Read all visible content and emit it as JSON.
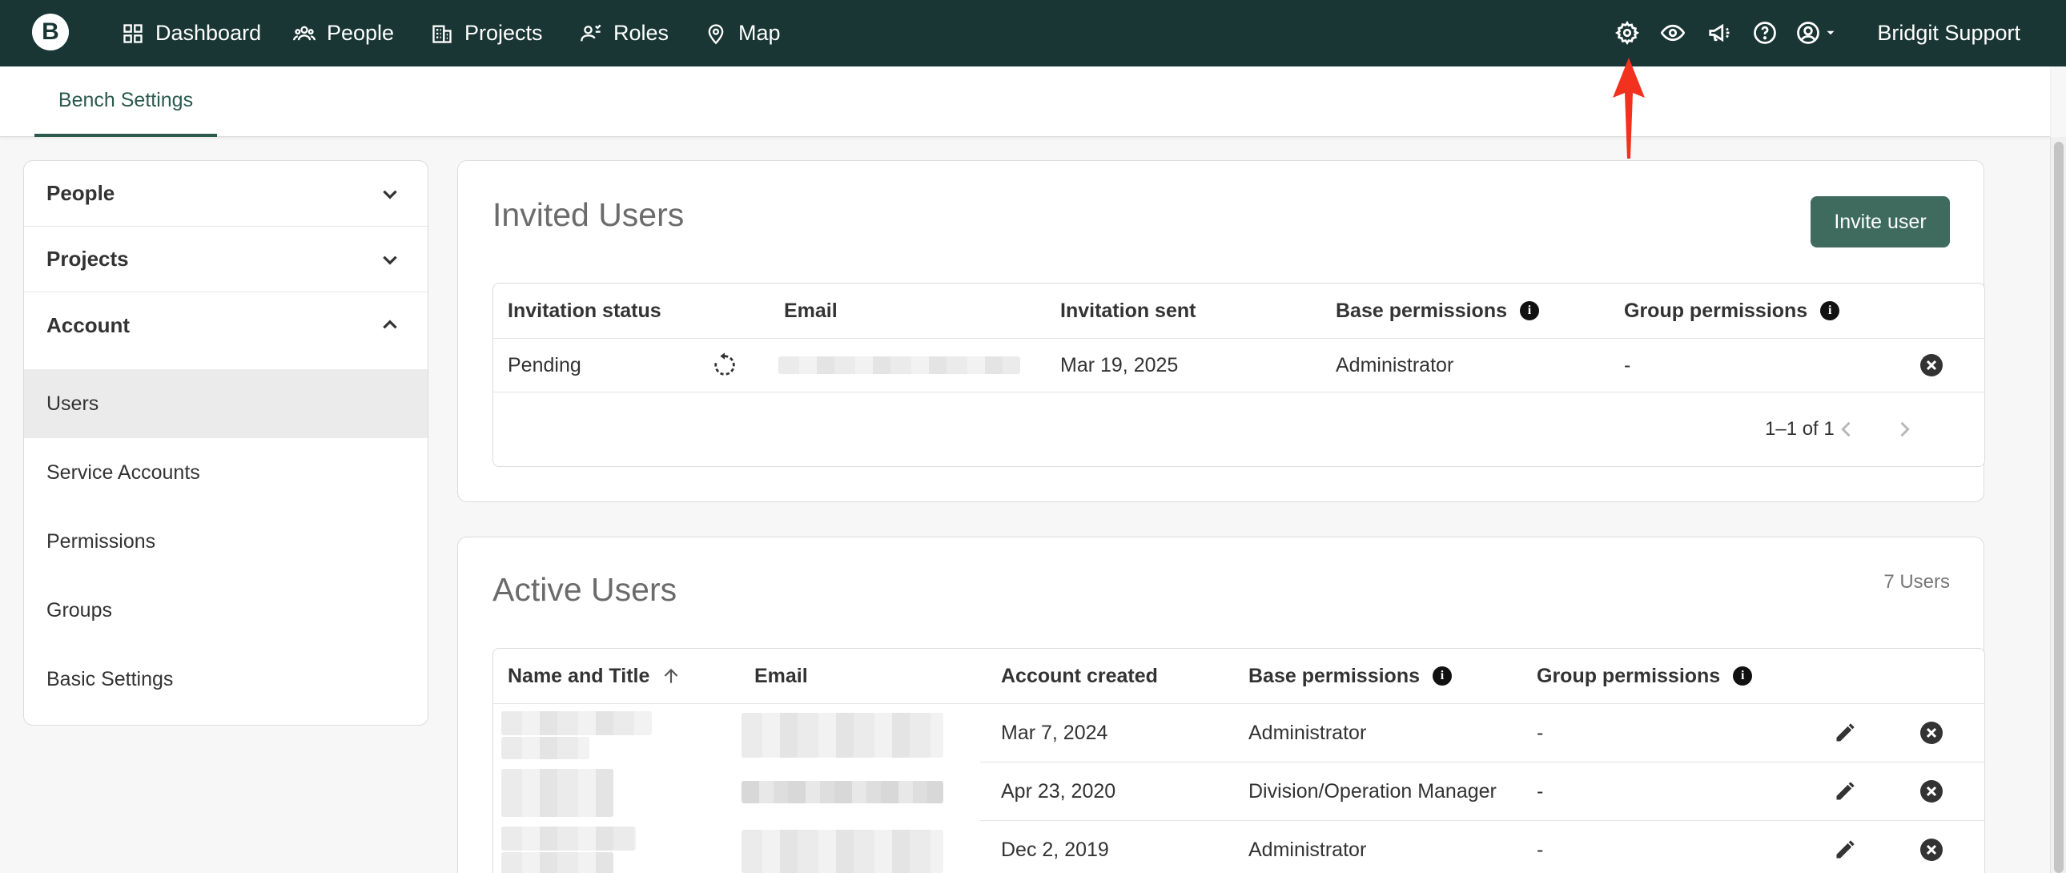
{
  "app": {
    "logo_letter": "B",
    "nav": [
      {
        "label": "Dashboard",
        "icon": "grid-icon"
      },
      {
        "label": "People",
        "icon": "people-icon"
      },
      {
        "label": "Projects",
        "icon": "building-icon"
      },
      {
        "label": "Roles",
        "icon": "roles-icon"
      },
      {
        "label": "Map",
        "icon": "map-pin-icon"
      }
    ],
    "right_icons": [
      "gear-icon",
      "eye-icon",
      "megaphone-icon",
      "help-icon",
      "account-icon"
    ],
    "user_name": "Bridgit Support"
  },
  "subheader": {
    "tab": "Bench Settings"
  },
  "sidebar": {
    "sections": [
      {
        "label": "People",
        "expanded": false
      },
      {
        "label": "Projects",
        "expanded": false
      },
      {
        "label": "Account",
        "expanded": true
      }
    ],
    "items": [
      "Users",
      "Service Accounts",
      "Permissions",
      "Groups",
      "Basic Settings"
    ],
    "active_item": "Users"
  },
  "invited": {
    "title": "Invited Users",
    "invite_button": "Invite user",
    "columns": [
      "Invitation status",
      "Email",
      "Invitation sent",
      "Base permissions",
      "Group permissions"
    ],
    "rows": [
      {
        "status": "Pending",
        "sent": "Mar 19, 2025",
        "base": "Administrator",
        "group": "-"
      }
    ],
    "pagination": "1–1 of 1"
  },
  "active": {
    "title": "Active Users",
    "count": "7 Users",
    "columns": [
      "Name and Title",
      "Email",
      "Account created",
      "Base permissions",
      "Group permissions"
    ],
    "rows": [
      {
        "created": "Mar 7, 2024",
        "base": "Administrator",
        "group": "-"
      },
      {
        "created": "Apr 23, 2020",
        "base": "Division/Operation Manager",
        "group": "-"
      },
      {
        "created": "Dec 2, 2019",
        "base": "Administrator",
        "group": "-"
      }
    ]
  },
  "colors": {
    "nav_bg": "#193634",
    "accent": "#3e6b5d",
    "tab_active": "#2b5b4e",
    "annotation_arrow": "#f2321e"
  }
}
